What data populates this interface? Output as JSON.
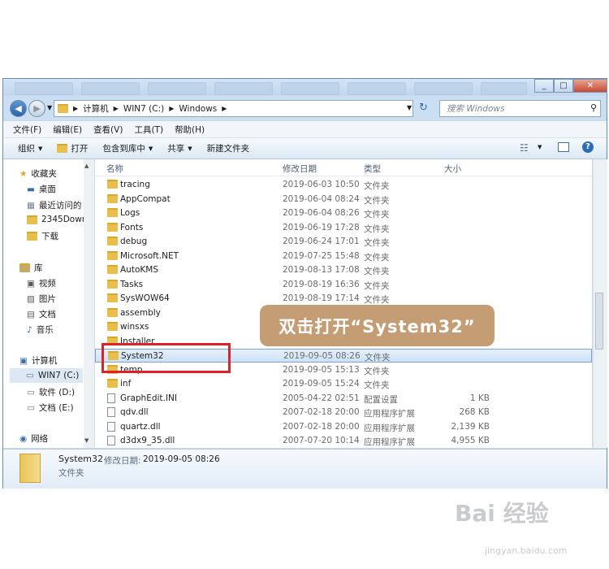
{
  "address": {
    "crumbs": [
      "计算机",
      "WIN7 (C:)",
      "Windows"
    ],
    "search_placeholder": "搜索 Windows"
  },
  "menu": [
    "文件(F)",
    "编辑(E)",
    "查看(V)",
    "工具(T)",
    "帮助(H)"
  ],
  "toolbar": {
    "organize": "组织",
    "open": "打开",
    "include": "包含到库中",
    "share": "共享",
    "new_folder": "新建文件夹"
  },
  "nav": {
    "favorites": "收藏夹",
    "desktop": "桌面",
    "recent": "最近访问的",
    "downloads_2345": "2345Dowr",
    "downloads": "下载",
    "libraries": "库",
    "videos": "视频",
    "pictures": "图片",
    "documents": "文档",
    "music": "音乐",
    "computer": "计算机",
    "drive_c": "WIN7 (C:)",
    "drive_d": "软件 (D:)",
    "drive_e": "文档 (E:)",
    "network": "网络"
  },
  "columns": {
    "name": "名称",
    "date": "修改日期",
    "type": "类型",
    "size": "大小"
  },
  "files": [
    {
      "name": "tracing",
      "date": "2019-06-03 10:50",
      "type": "文件夹",
      "size": "",
      "icon": "folder-icon"
    },
    {
      "name": "AppCompat",
      "date": "2019-06-04 08:24",
      "type": "文件夹",
      "size": "",
      "icon": "folder-icon"
    },
    {
      "name": "Logs",
      "date": "2019-06-04 08:26",
      "type": "文件夹",
      "size": "",
      "icon": "folder-icon"
    },
    {
      "name": "Fonts",
      "date": "2019-06-19 17:28",
      "type": "文件夹",
      "size": "",
      "icon": "folder-icon"
    },
    {
      "name": "debug",
      "date": "2019-06-24 17:01",
      "type": "文件夹",
      "size": "",
      "icon": "folder-icon"
    },
    {
      "name": "Microsoft.NET",
      "date": "2019-07-25 15:48",
      "type": "文件夹",
      "size": "",
      "icon": "folder-icon"
    },
    {
      "name": "AutoKMS",
      "date": "2019-08-13 17:08",
      "type": "文件夹",
      "size": "",
      "icon": "folder-icon"
    },
    {
      "name": "Tasks",
      "date": "2019-08-19 16:36",
      "type": "文件夹",
      "size": "",
      "icon": "folder-icon"
    },
    {
      "name": "SysWOW64",
      "date": "2019-08-19 17:14",
      "type": "文件夹",
      "size": "",
      "icon": "folder-icon"
    },
    {
      "name": "assembly",
      "date": "",
      "type": "",
      "size": "",
      "icon": "folder-icon"
    },
    {
      "name": "winsxs",
      "date": "",
      "type": "",
      "size": "",
      "icon": "folder-icon"
    },
    {
      "name": "Installer",
      "date": "",
      "type": "",
      "size": "",
      "icon": "folder-icon"
    },
    {
      "name": "System32",
      "date": "2019-09-05 08:26",
      "type": "文件夹",
      "size": "",
      "icon": "folder-icon"
    },
    {
      "name": "temp",
      "date": "2019-09-05 15:13",
      "type": "文件夹",
      "size": "",
      "icon": "folder-icon"
    },
    {
      "name": "inf",
      "date": "2019-09-05 15:24",
      "type": "文件夹",
      "size": "",
      "icon": "folder-icon"
    },
    {
      "name": "GraphEdit.INI",
      "date": "2005-04-22 02:51",
      "type": "配置设置",
      "size": "1 KB",
      "icon": "ini-file-icon"
    },
    {
      "name": "qdv.dll",
      "date": "2007-02-18 20:00",
      "type": "应用程序扩展",
      "size": "268 KB",
      "icon": "dll-file-icon"
    },
    {
      "name": "quartz.dll",
      "date": "2007-02-18 20:00",
      "type": "应用程序扩展",
      "size": "2,139 KB",
      "icon": "dll-file-icon"
    },
    {
      "name": "d3dx9_35.dll",
      "date": "2007-07-20 10:14",
      "type": "应用程序扩展",
      "size": "4,955 KB",
      "icon": "dll-file-icon"
    }
  ],
  "details": {
    "name": "System32",
    "date_label": "修改日期:",
    "date": "2019-09-05 08:26",
    "type": "文件夹"
  },
  "annotation": "双击打开“System32”",
  "watermark": "Bai 经验",
  "watermark_url": "jingyan.baidu.com"
}
